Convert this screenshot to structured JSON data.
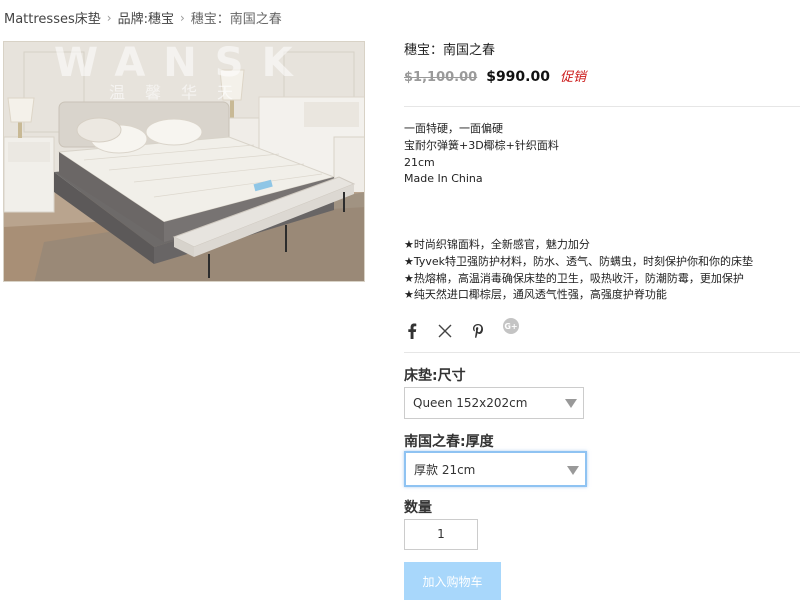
{
  "breadcrumb": {
    "items": [
      "Mattresses床垫",
      "品牌:穗宝",
      "穗宝：南国之春"
    ]
  },
  "product": {
    "title": "穗宝：南国之春",
    "old_price": "$1,100.00",
    "price": "$990.00",
    "promo": "促销",
    "image_watermark": "WANSK 温 馨 华 天",
    "description": [
      "一面特硬，一面偏硬",
      "宝耐尔弹簧+3D椰棕+针织面料",
      "21cm",
      "Made In China"
    ],
    "features": [
      "★时尚织锦面料，全新感官，魅力加分",
      "★Tyvek特卫强防护材料，防水、透气、防螨虫，时刻保护你和你的床垫",
      "★热熔棉，高温消毒确保床垫的卫生，吸热收汗，防潮防霉，更加保护",
      "★纯天然进口椰棕层，通风透气性强，高强度护脊功能"
    ]
  },
  "share": {
    "icons": [
      "facebook-icon",
      "x-icon",
      "pinterest-icon",
      "google-plus-icon"
    ]
  },
  "options": {
    "size_label": "床垫:尺寸",
    "size_value": "Queen 152x202cm",
    "thickness_label": "南国之春:厚度",
    "thickness_value": "厚款 21cm",
    "qty_label": "数量",
    "qty_value": "1"
  },
  "cart": {
    "label": "加入购物车"
  },
  "colors": {
    "promo": "#cc1b1b",
    "cart_button": "#a8d7fb",
    "focus_border": "#8fc3f2"
  }
}
